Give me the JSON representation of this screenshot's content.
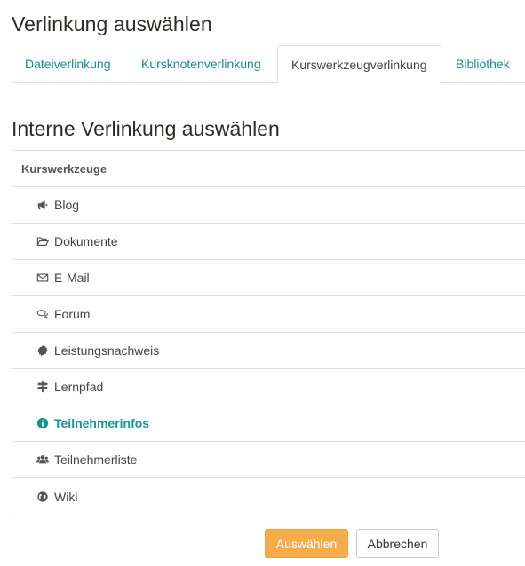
{
  "dialog": {
    "title": "Verlinkung auswählen"
  },
  "tabs": [
    {
      "label": "Dateiverlinkung",
      "active": false
    },
    {
      "label": "Kursknotenverlinkung",
      "active": false
    },
    {
      "label": "Kurswerkzeugverlinkung",
      "active": true
    },
    {
      "label": "Bibliothek",
      "active": false
    }
  ],
  "section": {
    "title": "Interne Verlinkung auswählen"
  },
  "tree": {
    "header": "Kurswerkzeuge",
    "items": [
      {
        "label": "Blog",
        "icon": "bullhorn-icon"
      },
      {
        "label": "Dokumente",
        "icon": "folder-open-icon"
      },
      {
        "label": "E-Mail",
        "icon": "envelope-icon"
      },
      {
        "label": "Forum",
        "icon": "comments-icon"
      },
      {
        "label": "Leistungsnachweis",
        "icon": "certificate-icon"
      },
      {
        "label": "Lernpfad",
        "icon": "signpost-icon"
      },
      {
        "label": "Teilnehmerinfos",
        "icon": "info-circle-icon",
        "selected": true
      },
      {
        "label": "Teilnehmerliste",
        "icon": "users-icon"
      },
      {
        "label": "Wiki",
        "icon": "globe-icon"
      }
    ]
  },
  "buttons": {
    "select": "Auswählen",
    "cancel": "Abbrechen"
  },
  "colors": {
    "link": "#1a8a8a",
    "selected": "#17948f",
    "primary": "#f5ad4b",
    "border": "#dddddd"
  }
}
